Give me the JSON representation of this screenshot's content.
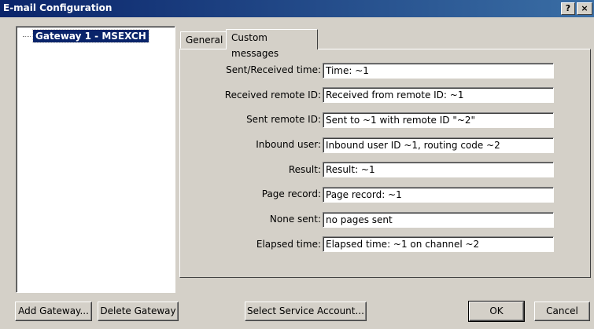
{
  "window": {
    "title": "E-mail Configuration",
    "help_label": "?",
    "close_label": "×"
  },
  "tree": {
    "items": [
      {
        "label": "Gateway 1 - MSEXCH"
      }
    ]
  },
  "tabs": [
    {
      "label": "General"
    },
    {
      "label": "Custom messages"
    }
  ],
  "fields": [
    {
      "label": "Sent/Received time:",
      "value": "Time: ~1"
    },
    {
      "label": "Received remote ID:",
      "value": "Received from remote ID: ~1"
    },
    {
      "label": "Sent remote ID:",
      "value": "Sent to ~1 with remote ID \"~2\""
    },
    {
      "label": "Inbound user:",
      "value": "Inbound user ID ~1, routing code ~2"
    },
    {
      "label": "Result:",
      "value": "Result: ~1"
    },
    {
      "label": "Page record:",
      "value": "Page record: ~1"
    },
    {
      "label": "None sent:",
      "value": "no pages sent"
    },
    {
      "label": "Elapsed time:",
      "value": "Elapsed time: ~1 on channel ~2"
    }
  ],
  "buttons": {
    "add_gateway": "Add Gateway...",
    "delete_gateway": "Delete Gateway",
    "select_service_account": "Select Service Account...",
    "ok": "OK",
    "cancel": "Cancel"
  },
  "colors": {
    "titlebar": "#0a246a",
    "dialog_bg": "#d4d0c8",
    "selection": "#0a246a"
  }
}
